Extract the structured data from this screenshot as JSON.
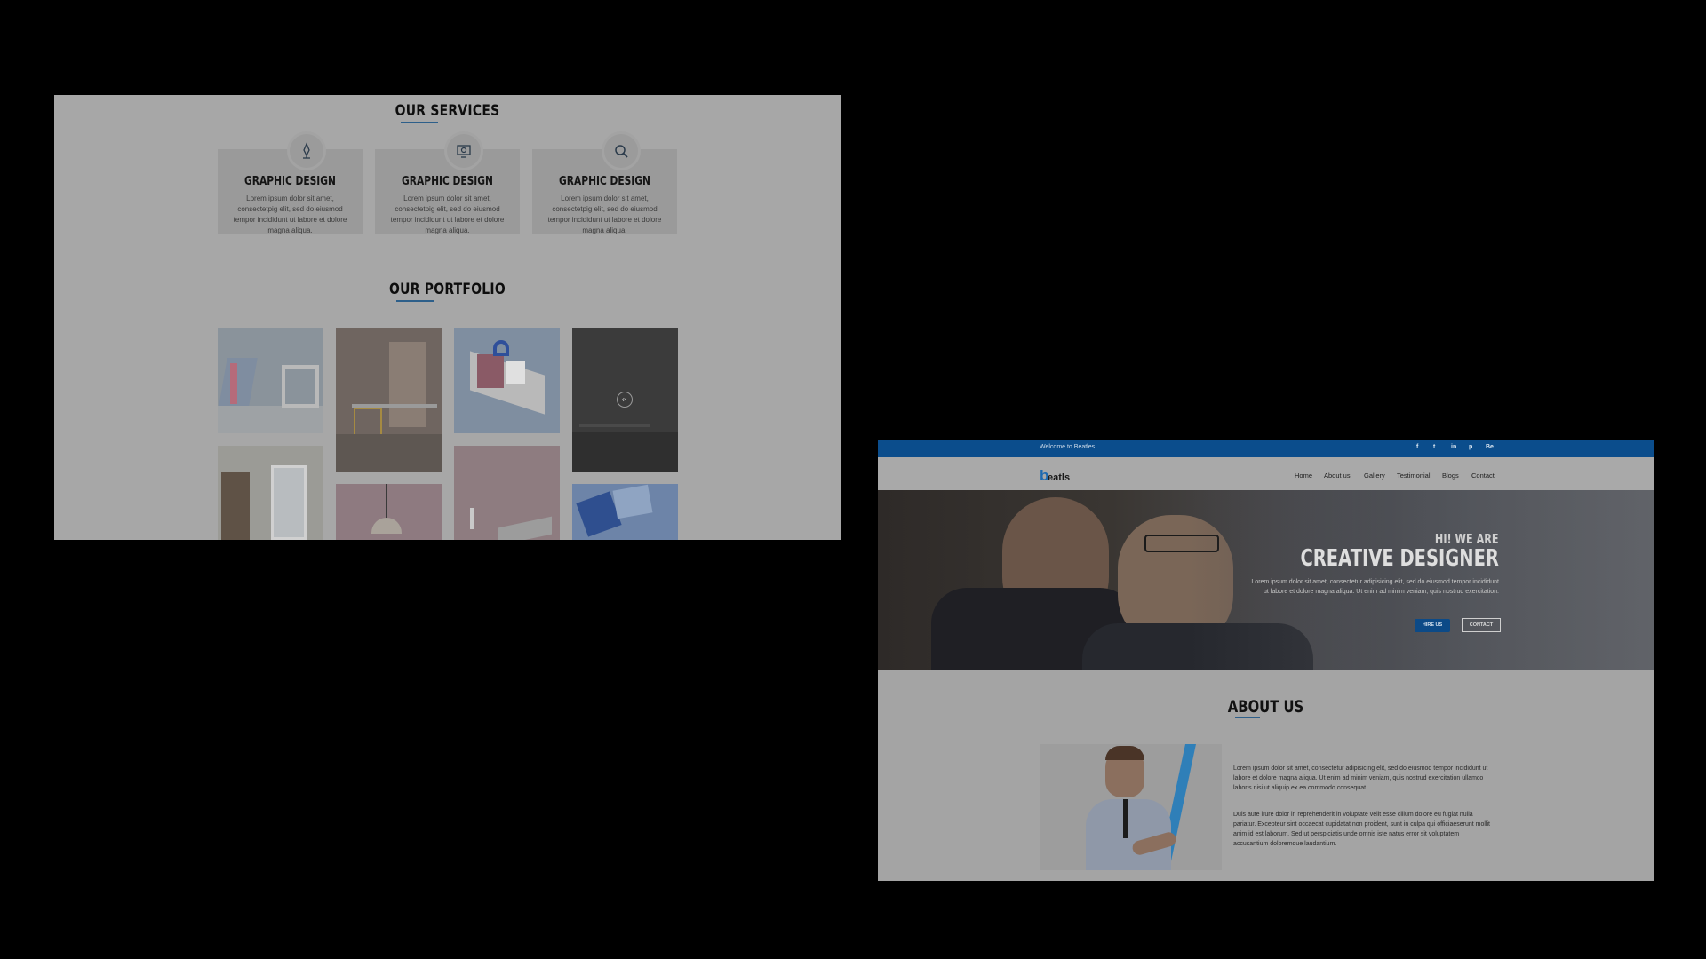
{
  "left_page": {
    "services": {
      "title": "OUR SERVICES",
      "cards": [
        {
          "icon": "pen-nib-icon",
          "title": "GRAPHIC DESIGN",
          "text": "Lorem ipsum dolor sit amet, consectetpig elit, sed do eiusmod tempor incididunt ut labore et dolore magna aliqua."
        },
        {
          "icon": "monitor-icon",
          "title": "GRAPHIC DESIGN",
          "text": "Lorem ipsum dolor sit amet, consectetpig elit, sed do eiusmod tempor incididunt ut labore et dolore magna aliqua."
        },
        {
          "icon": "search-icon",
          "title": "GRAPHIC DESIGN",
          "text": "Lorem ipsum dolor sit amet, consectetpig elit, sed do eiusmod tempor incididunt ut labore et dolore magna aliqua."
        }
      ]
    },
    "portfolio": {
      "title": "OUR PORTFOLIO",
      "hover_icon": "link-icon"
    }
  },
  "right_page": {
    "topbar": {
      "welcome": "Welcome to Beatles",
      "social": [
        "f",
        "t",
        "in",
        "p",
        "Be"
      ]
    },
    "logo": {
      "letter": "b",
      "text": "eatls"
    },
    "nav": [
      "Home",
      "About us",
      "Gallery",
      "Testimonial",
      "Blogs",
      "Contact"
    ],
    "hero": {
      "subtitle": "HI! WE ARE",
      "title": "CREATIVE DESIGNER",
      "text": "Lorem ipsum dolor sit amet, consectetur adipisicing elit, sed do eiusmod tempor incididunt ut labore et dolore magna aliqua. Ut enim ad minim veniam, quis nostrud exercitation.",
      "hire_label": "HIRE US",
      "contact_label": "CONTACT"
    },
    "about": {
      "title": "ABOUT US",
      "paragraph1": "Lorem ipsum dolor sit amet, consectetur adipisicing elit, sed do eiusmod tempor incididunt ut labore et dolore magna aliqua. Ut enim ad minim veniam, quis nostrud exercitation ullamco laboris nisi ut aliquip ex ea commodo consequat.",
      "paragraph2": "Duis aute irure dolor in reprehenderit in voluptate velit esse cillum dolore eu fugiat nulla pariatur. Excepteur sint occaecat cupidatat non proident, sunt in culpa qui officiaeserunt mollit anim id est laborum. Sed ut perspiciatis unde omnis iste natus error sit voluptatem accusantium doloremque laudantium."
    }
  },
  "colors": {
    "brand_blue": "#0b4d8c",
    "accent": "#2d8fd0",
    "backdrop": "#000000"
  }
}
